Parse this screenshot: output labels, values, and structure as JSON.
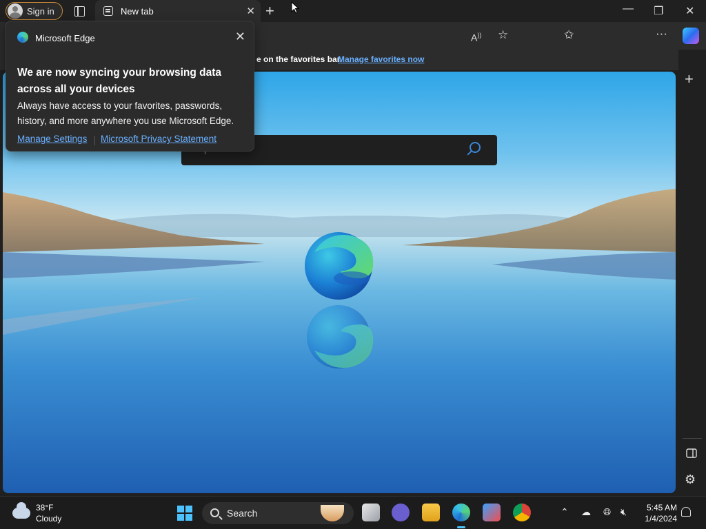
{
  "browser": {
    "sign_in_label": "Sign in",
    "tab_title": "New tab",
    "favorites_bar_text": "e on the favorites bar.",
    "favorites_bar_link": "Manage favorites now"
  },
  "popup": {
    "header": "Microsoft Edge",
    "heading": "We are now syncing your browsing data across all your devices",
    "body": "Always have access to your favorites, passwords, history, and more anywhere you use Microsoft Edge.",
    "link_settings": "Manage Settings",
    "link_privacy": "Microsoft Privacy Statement"
  },
  "taskbar": {
    "weather_temp": "38°F",
    "weather_desc": "Cloudy",
    "search_label": "Search",
    "time": "5:45 AM",
    "date": "1/4/2024"
  },
  "colors": {
    "accent": "#4cc2ff",
    "link": "#6ab0ff"
  },
  "icons": [
    "tab-actions-icon",
    "new-tab-icon",
    "minimize-icon",
    "maximize-icon",
    "close-icon",
    "read-aloud-icon",
    "favorite-star-icon",
    "split-screen-icon",
    "favorites-icon",
    "collections-icon",
    "performance-icon",
    "more-icon",
    "copilot-icon",
    "search-icon",
    "settings-gear-icon",
    "sidebar-toggle-icon",
    "notification-bell-icon"
  ]
}
